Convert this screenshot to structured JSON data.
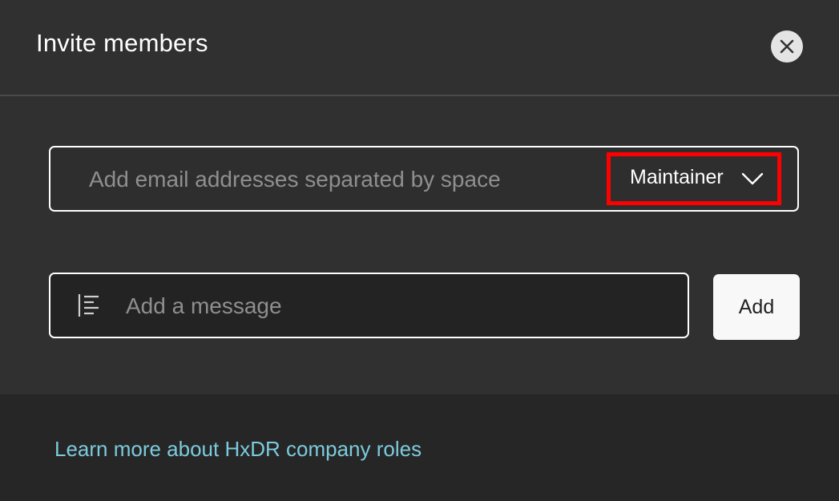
{
  "dialog": {
    "title": "Invite members",
    "close_icon": "close-icon"
  },
  "email": {
    "value": "",
    "placeholder": "Add email addresses separated by space",
    "role": {
      "selected": "Maintainer",
      "icon": "chevron-down-icon"
    }
  },
  "message": {
    "value": "",
    "placeholder": "Add a message",
    "icon": "text-align-icon"
  },
  "actions": {
    "add_label": "Add"
  },
  "footer": {
    "link_text": "Learn more about HxDR company roles"
  },
  "colors": {
    "highlight": "#ff0000",
    "link": "#7ccbdc"
  }
}
